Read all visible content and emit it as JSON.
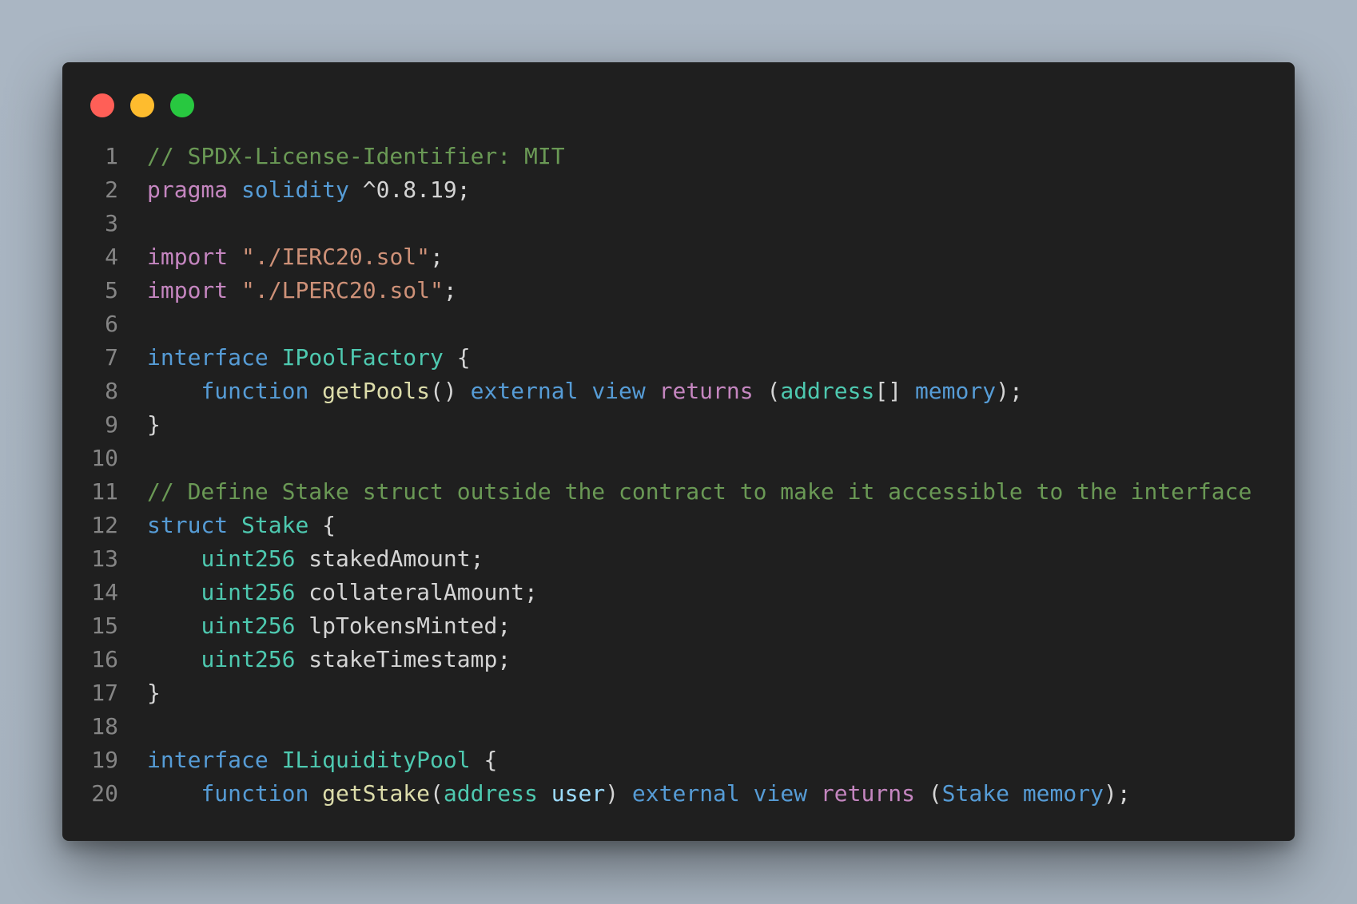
{
  "window": {
    "buttons": {
      "close_color": "#ff5f57",
      "minimize_color": "#febc2e",
      "maximize_color": "#28c840"
    }
  },
  "theme": {
    "background": "#1f1f1f",
    "line_number": "#858585",
    "comment": "#6a9955",
    "keyword": "#c586c0",
    "storage": "#569cd6",
    "type": "#4ec9b0",
    "string": "#ce9178",
    "function": "#dcdcaa",
    "parameter": "#9cdcfe",
    "plain": "#d4d4d4"
  },
  "editor": {
    "language": "Solidity",
    "lines": [
      {
        "n": "1",
        "tokens": [
          {
            "t": "// SPDX-License-Identifier: MIT",
            "k": "comment"
          }
        ]
      },
      {
        "n": "2",
        "tokens": [
          {
            "t": "pragma",
            "k": "keyword"
          },
          {
            "t": " ",
            "k": "plain"
          },
          {
            "t": "solidity",
            "k": "storage"
          },
          {
            "t": " ^0.8.19;",
            "k": "plain"
          }
        ]
      },
      {
        "n": "3",
        "tokens": []
      },
      {
        "n": "4",
        "tokens": [
          {
            "t": "import",
            "k": "keyword"
          },
          {
            "t": " ",
            "k": "plain"
          },
          {
            "t": "\"./IERC20.sol\"",
            "k": "string"
          },
          {
            "t": ";",
            "k": "plain"
          }
        ]
      },
      {
        "n": "5",
        "tokens": [
          {
            "t": "import",
            "k": "keyword"
          },
          {
            "t": " ",
            "k": "plain"
          },
          {
            "t": "\"./LPERC20.sol\"",
            "k": "string"
          },
          {
            "t": ";",
            "k": "plain"
          }
        ]
      },
      {
        "n": "6",
        "tokens": []
      },
      {
        "n": "7",
        "tokens": [
          {
            "t": "interface",
            "k": "storage"
          },
          {
            "t": " ",
            "k": "plain"
          },
          {
            "t": "IPoolFactory",
            "k": "type"
          },
          {
            "t": " {",
            "k": "plain"
          }
        ]
      },
      {
        "n": "8",
        "tokens": [
          {
            "t": "    ",
            "k": "plain"
          },
          {
            "t": "function",
            "k": "storage"
          },
          {
            "t": " ",
            "k": "plain"
          },
          {
            "t": "getPools",
            "k": "func"
          },
          {
            "t": "() ",
            "k": "plain"
          },
          {
            "t": "external",
            "k": "storage"
          },
          {
            "t": " ",
            "k": "plain"
          },
          {
            "t": "view",
            "k": "storage"
          },
          {
            "t": " ",
            "k": "plain"
          },
          {
            "t": "returns",
            "k": "keyword"
          },
          {
            "t": " (",
            "k": "plain"
          },
          {
            "t": "address",
            "k": "type"
          },
          {
            "t": "[] ",
            "k": "plain"
          },
          {
            "t": "memory",
            "k": "storage"
          },
          {
            "t": ");",
            "k": "plain"
          }
        ]
      },
      {
        "n": "9",
        "tokens": [
          {
            "t": "}",
            "k": "plain"
          }
        ]
      },
      {
        "n": "10",
        "tokens": []
      },
      {
        "n": "11",
        "tokens": [
          {
            "t": "// Define Stake struct outside the contract to make it accessible to the interface",
            "k": "comment"
          }
        ]
      },
      {
        "n": "12",
        "tokens": [
          {
            "t": "struct",
            "k": "storage"
          },
          {
            "t": " ",
            "k": "plain"
          },
          {
            "t": "Stake",
            "k": "type"
          },
          {
            "t": " {",
            "k": "plain"
          }
        ]
      },
      {
        "n": "13",
        "tokens": [
          {
            "t": "    ",
            "k": "plain"
          },
          {
            "t": "uint256",
            "k": "type"
          },
          {
            "t": " stakedAmount;",
            "k": "plain"
          }
        ]
      },
      {
        "n": "14",
        "tokens": [
          {
            "t": "    ",
            "k": "plain"
          },
          {
            "t": "uint256",
            "k": "type"
          },
          {
            "t": " collateralAmount;",
            "k": "plain"
          }
        ]
      },
      {
        "n": "15",
        "tokens": [
          {
            "t": "    ",
            "k": "plain"
          },
          {
            "t": "uint256",
            "k": "type"
          },
          {
            "t": " lpTokensMinted;",
            "k": "plain"
          }
        ]
      },
      {
        "n": "16",
        "tokens": [
          {
            "t": "    ",
            "k": "plain"
          },
          {
            "t": "uint256",
            "k": "type"
          },
          {
            "t": " stakeTimestamp;",
            "k": "plain"
          }
        ]
      },
      {
        "n": "17",
        "tokens": [
          {
            "t": "}",
            "k": "plain"
          }
        ]
      },
      {
        "n": "18",
        "tokens": []
      },
      {
        "n": "19",
        "tokens": [
          {
            "t": "interface",
            "k": "storage"
          },
          {
            "t": " ",
            "k": "plain"
          },
          {
            "t": "ILiquidityPool",
            "k": "type"
          },
          {
            "t": " {",
            "k": "plain"
          }
        ]
      },
      {
        "n": "20",
        "tokens": [
          {
            "t": "    ",
            "k": "plain"
          },
          {
            "t": "function",
            "k": "storage"
          },
          {
            "t": " ",
            "k": "plain"
          },
          {
            "t": "getStake",
            "k": "func"
          },
          {
            "t": "(",
            "k": "plain"
          },
          {
            "t": "address",
            "k": "type"
          },
          {
            "t": " ",
            "k": "plain"
          },
          {
            "t": "user",
            "k": "param"
          },
          {
            "t": ") ",
            "k": "plain"
          },
          {
            "t": "external",
            "k": "storage"
          },
          {
            "t": " ",
            "k": "plain"
          },
          {
            "t": "view",
            "k": "storage"
          },
          {
            "t": " ",
            "k": "plain"
          },
          {
            "t": "returns",
            "k": "keyword"
          },
          {
            "t": " (",
            "k": "plain"
          },
          {
            "t": "Stake",
            "k": "storage"
          },
          {
            "t": " ",
            "k": "plain"
          },
          {
            "t": "memory",
            "k": "storage"
          },
          {
            "t": ");",
            "k": "plain"
          }
        ]
      }
    ]
  }
}
